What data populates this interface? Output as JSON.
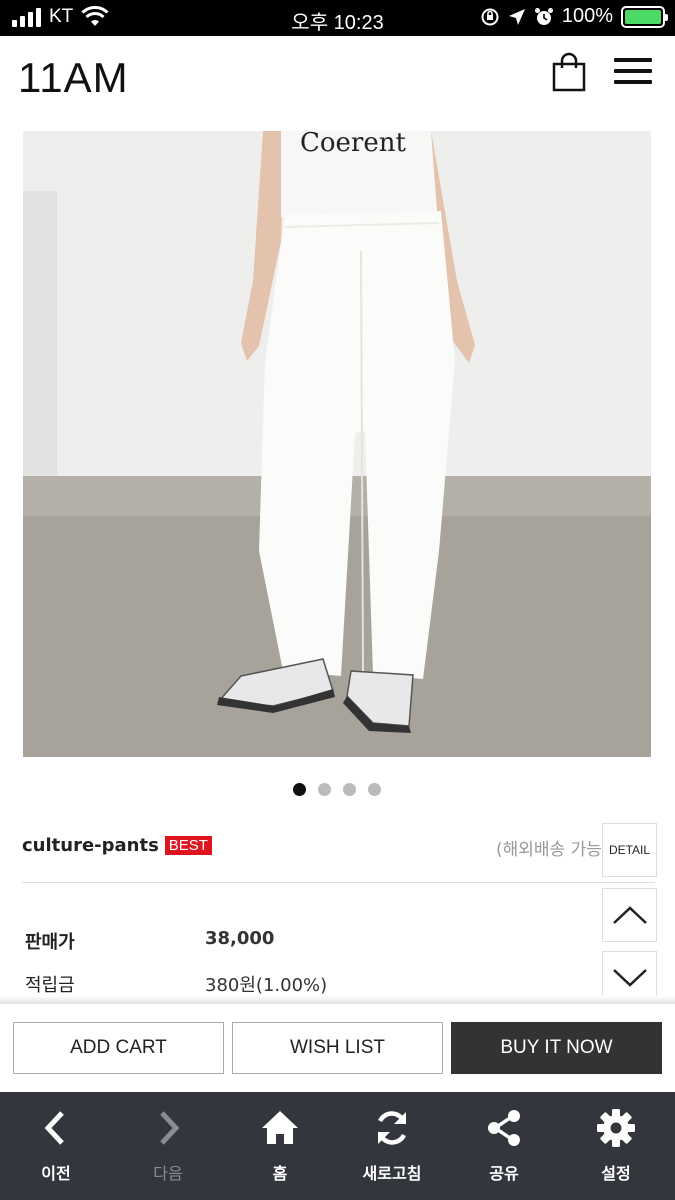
{
  "status_bar": {
    "carrier": "KT",
    "time": "오후 10:23",
    "battery": "100%",
    "icons": [
      "signal-icon",
      "wifi-icon",
      "orientation-lock-icon",
      "location-icon",
      "alarm-icon",
      "battery-icon"
    ]
  },
  "header": {
    "logo": "11AM",
    "cart_icon": "shopping-bag-icon",
    "menu_icon": "hamburger-menu-icon"
  },
  "product": {
    "image_text": "Coerent",
    "carousel": {
      "count": 4,
      "active_index": 0
    },
    "name": "culture-pants",
    "badge": "BEST",
    "shipping_note": "(해외배송 가능상품)",
    "rows": [
      {
        "label": "판매가",
        "value": "38,000"
      },
      {
        "label": "적립금",
        "value": "380원(1.00%)"
      }
    ]
  },
  "side_buttons": {
    "detail": "DETAIL",
    "up_icon": "chevron-up-icon",
    "down_icon": "chevron-down-icon"
  },
  "actions": {
    "add_cart": "ADD CART",
    "wish_list": "WISH LIST",
    "buy_now": "BUY IT NOW"
  },
  "toolbar": {
    "items": [
      {
        "label": "이전",
        "icon": "back-icon",
        "enabled": true
      },
      {
        "label": "다음",
        "icon": "forward-icon",
        "enabled": false
      },
      {
        "label": "홈",
        "icon": "home-icon",
        "enabled": true
      },
      {
        "label": "새로고침",
        "icon": "refresh-icon",
        "enabled": true
      },
      {
        "label": "공유",
        "icon": "share-icon",
        "enabled": true
      },
      {
        "label": "설정",
        "icon": "settings-icon",
        "enabled": true
      }
    ]
  },
  "colors": {
    "badge_red": "#e0141e",
    "buy_button": "#333333",
    "toolbar_bg": "#33363d"
  }
}
